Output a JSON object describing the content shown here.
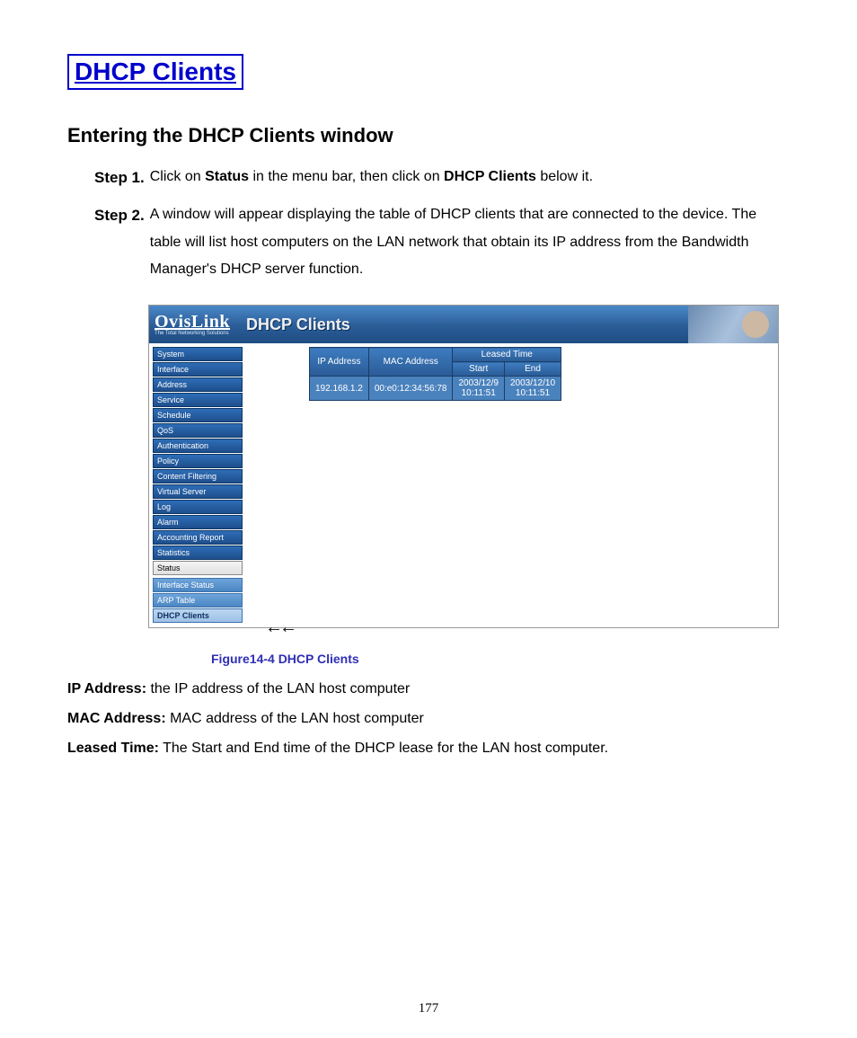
{
  "title": "DHCP Clients",
  "section_heading": "Entering the DHCP Clients window",
  "steps": [
    {
      "label": "Step 1.",
      "parts": [
        {
          "t": "Click on "
        },
        {
          "t": "Status",
          "b": true
        },
        {
          "t": " in the menu bar, then click on "
        },
        {
          "t": "DHCP Clients",
          "b": true
        },
        {
          "t": " below it."
        }
      ]
    },
    {
      "label": "Step 2.",
      "parts": [
        {
          "t": "A window will appear displaying the table of DHCP clients that are connected to the device.   The table will list host computers on the LAN network that obtain its IP address from the Bandwidth Manager's DHCP server function."
        }
      ]
    }
  ],
  "screenshot": {
    "brand": "OvisLink",
    "tagline": "The Total Networking Solutions",
    "page_title": "DHCP Clients",
    "sidebar": {
      "main": [
        "System",
        "Interface",
        "Address",
        "Service",
        "Schedule",
        "QoS",
        "Authentication",
        "Policy",
        "Content Filtering",
        "Virtual Server",
        "Log",
        "Alarm",
        "Accounting Report",
        "Statistics"
      ],
      "active": "Status",
      "sub": [
        "Interface Status",
        "ARP Table",
        "DHCP Clients"
      ]
    },
    "pointer": "←←",
    "table": {
      "headers": {
        "ip": "IP Address",
        "mac": "MAC Address",
        "leased": "Leased Time",
        "start": "Start",
        "end": "End"
      },
      "row": {
        "ip": "192.168.1.2",
        "mac": "00:e0:12:34:56:78",
        "start_date": "2003/12/9",
        "start_time": "10:11:51",
        "end_date": "2003/12/10",
        "end_time": "10:11:51"
      }
    }
  },
  "caption": "Figure14-4    DHCP Clients",
  "definitions": [
    {
      "label": "IP Address:",
      "text": "   the IP address of the LAN host computer"
    },
    {
      "label": "MAC Address:",
      "text": "   MAC address of the LAN host computer"
    },
    {
      "label": "Leased Time:",
      "text": " The Start and End time of the DHCP lease for the LAN host computer."
    }
  ],
  "page_number": "177"
}
